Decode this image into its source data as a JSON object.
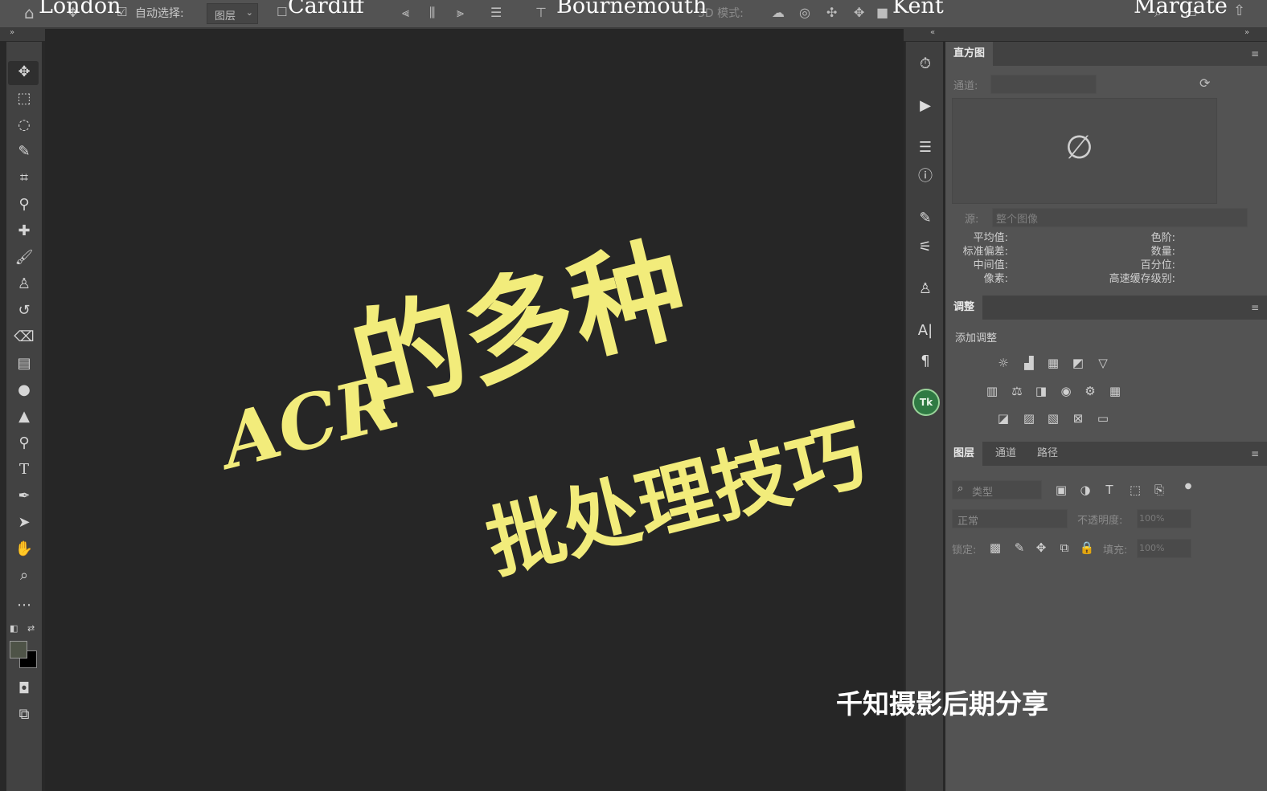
{
  "optionsbar": {
    "auto_select_label": "自动选择:",
    "auto_select_value": "图层",
    "mode_label": "3D 模式:"
  },
  "watermark_labels": [
    "London",
    "Cardiff",
    "Bournemouth",
    "Kent",
    "Margate"
  ],
  "tools": [
    "move-tool",
    "marquee-tool",
    "lasso-tool",
    "quick-select-tool",
    "crop-tool",
    "eyedropper-tool",
    "healing-brush-tool",
    "brush-tool",
    "clone-stamp-tool",
    "history-brush-tool",
    "eraser-tool",
    "gradient-tool",
    "blur-tool",
    "sharpen-tool",
    "dodge-tool",
    "type-tool",
    "pen-tool",
    "path-select-tool",
    "hand-tool",
    "zoom-tool",
    "more-tools"
  ],
  "colors": {
    "foreground": "#4e5347",
    "background": "#000000",
    "overlay_text": "#f2ec7b",
    "ui_dark": "#262626",
    "panel": "#535353"
  },
  "histogram": {
    "tab": "直方图",
    "channel_label": "通道:",
    "no_data_symbol": "∅",
    "source_label": "源:",
    "source_value": "整个图像",
    "stats_left": [
      "平均值:",
      "标准偏差:",
      "中间值:",
      "像素:"
    ],
    "stats_right": [
      "色阶:",
      "数量:",
      "百分位:",
      "高速缓存级别:"
    ]
  },
  "adjustments": {
    "tab": "调整",
    "add_label": "添加调整"
  },
  "layers": {
    "tabs": [
      "图层",
      "通道",
      "路径"
    ],
    "filter_placeholder": "类型",
    "blend_mode": "正常",
    "opacity_label": "不透明度:",
    "opacity_value": "100%",
    "lock_label": "锁定:",
    "fill_label": "填充:",
    "fill_value": "100%"
  },
  "overlay": {
    "acr": "ACR",
    "line1": "的多种",
    "line2": "批处理技巧",
    "credit": "千知摄影后期分享"
  }
}
